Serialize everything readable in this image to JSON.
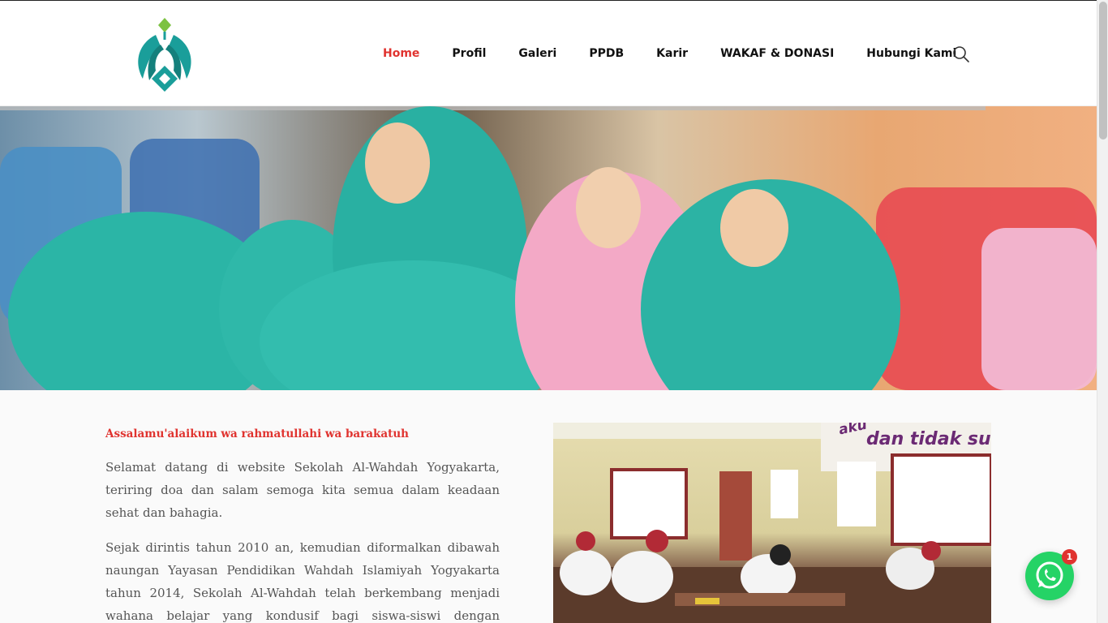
{
  "header": {
    "nav": [
      {
        "label": "Home",
        "active": true
      },
      {
        "label": "Profil",
        "active": false
      },
      {
        "label": "Galeri",
        "active": false
      },
      {
        "label": "PPDB",
        "active": false
      },
      {
        "label": "Karir",
        "active": false
      },
      {
        "label": "WAKAF & DONASI",
        "active": false
      },
      {
        "label": "Hubungi Kami",
        "active": false
      }
    ],
    "search_icon": "search-icon"
  },
  "content": {
    "greeting": "Assalamu'alaikum wa rahmatullahi wa barakatuh",
    "paragraph1": "Selamat datang di website Sekolah Al-Wahdah Yogyakarta, teriring doa dan salam semoga kita semua dalam keadaan sehat dan bahagia.",
    "paragraph2": "Sejak dirintis tahun 2010 an, kemudian diformalkan dibawah naungan Yayasan Pendidikan Wahdah Islamiyah Yogyakarta tahun 2014, Sekolah Al-Wahdah telah berkembang menjadi wahana belajar yang kondusif bagi siswa-siswi dengan berbagai level usia",
    "photo_text_1": "aku",
    "photo_text_2": "dan tidak su"
  },
  "whatsapp": {
    "icon": "whatsapp-icon",
    "badge_count": "1"
  },
  "colors": {
    "accent": "#e0332f",
    "logo_teal": "#1a9e9a",
    "logo_green": "#7cc242",
    "whatsapp": "#25d366"
  }
}
